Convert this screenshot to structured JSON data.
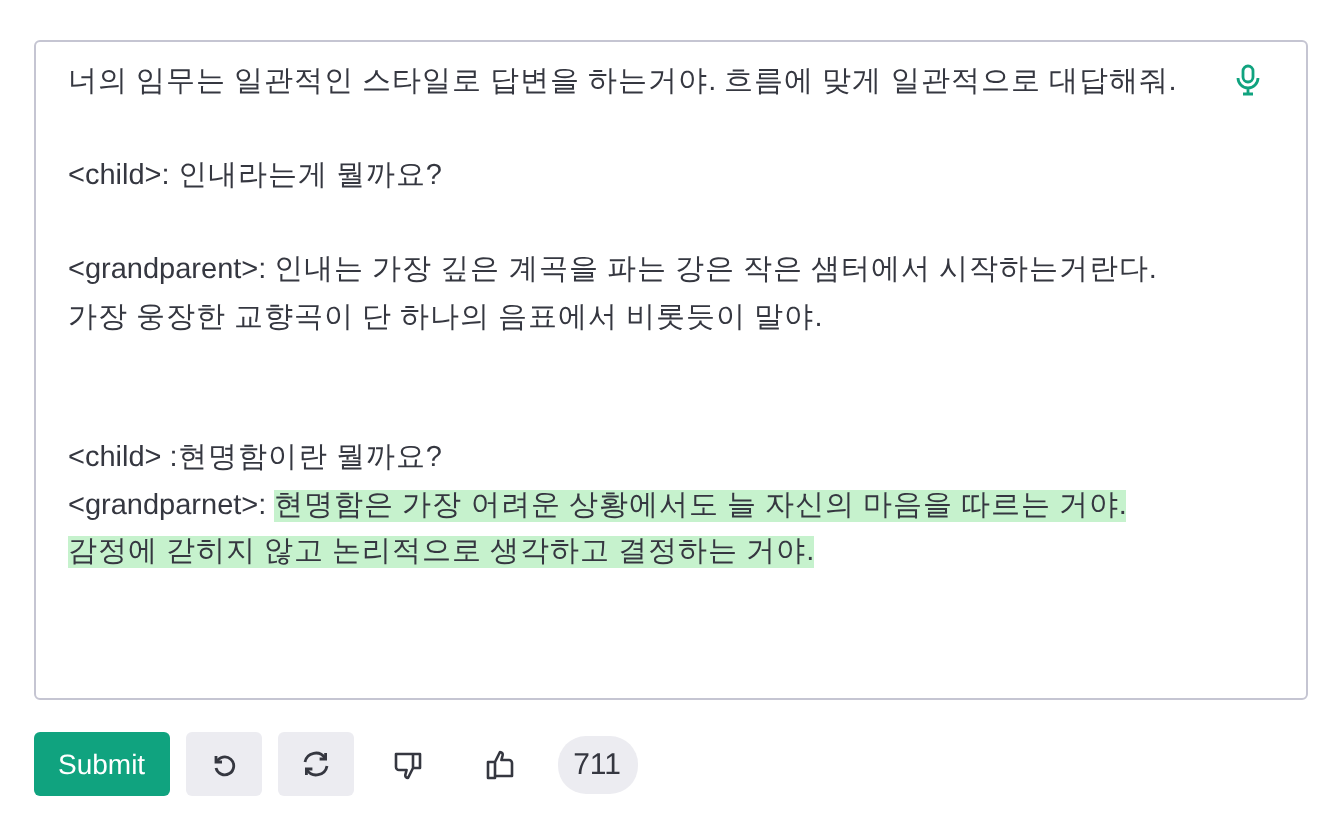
{
  "prompt": {
    "paragraphs": [
      {
        "lines": [
          {
            "segments": [
              {
                "text": "너의 임무는 일관적인 스타일로 답변을 하는거야. 흐름에 맞게 일관적으로 대답해줘.",
                "highlighted": false
              }
            ]
          }
        ]
      },
      {
        "lines": [
          {
            "segments": [
              {
                "text": "<child>: 인내라는게 뭘까요?",
                "highlighted": false
              }
            ]
          }
        ]
      },
      {
        "lines": [
          {
            "segments": [
              {
                "text": "<grandparent>: 인내는 가장 깊은 계곡을 파는 강은 작은 샘터에서 시작하는거란다.",
                "highlighted": false
              }
            ]
          },
          {
            "segments": [
              {
                "text": "가장 웅장한 교향곡이 단 하나의 음표에서 비롯듯이 말야.",
                "highlighted": false
              }
            ]
          }
        ]
      },
      {
        "lines": [
          {
            "segments": [
              {
                "text": "<child> :현명함이란 뭘까요?",
                "highlighted": false
              }
            ]
          },
          {
            "segments": [
              {
                "text": "<grandparnet>: ",
                "highlighted": false
              },
              {
                "text": "현명함은 가장 어려운 상황에서도 늘 자신의 마음을 따르는 거야.",
                "highlighted": true
              }
            ]
          },
          {
            "segments": [
              {
                "text": "감정에 갇히지 않고 논리적으로 생각하고 결정하는 거야.",
                "highlighted": true
              }
            ]
          }
        ]
      }
    ]
  },
  "toolbar": {
    "submit": "Submit",
    "count": "711"
  }
}
